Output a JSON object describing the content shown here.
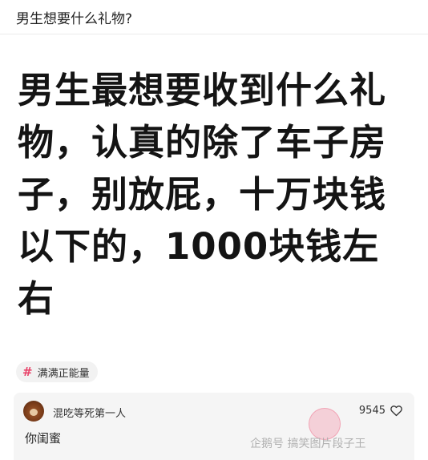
{
  "header": {
    "question": "男生想要什么礼物?"
  },
  "post": {
    "title": "男生最想要收到什么礼物，认真的除了车子房子，别放屁，十万块钱以下的，1000块钱左右"
  },
  "tag": {
    "icon": "hash-icon",
    "symbol": "#",
    "label": "满满正能量",
    "color": "#e8446a"
  },
  "answer": {
    "author": "混吃等死第一人",
    "likes": "9545",
    "like_icon": "heart-like-icon",
    "content": "你闺蜜"
  },
  "source": {
    "label": "企鹅号 搞笑图片段子王"
  }
}
